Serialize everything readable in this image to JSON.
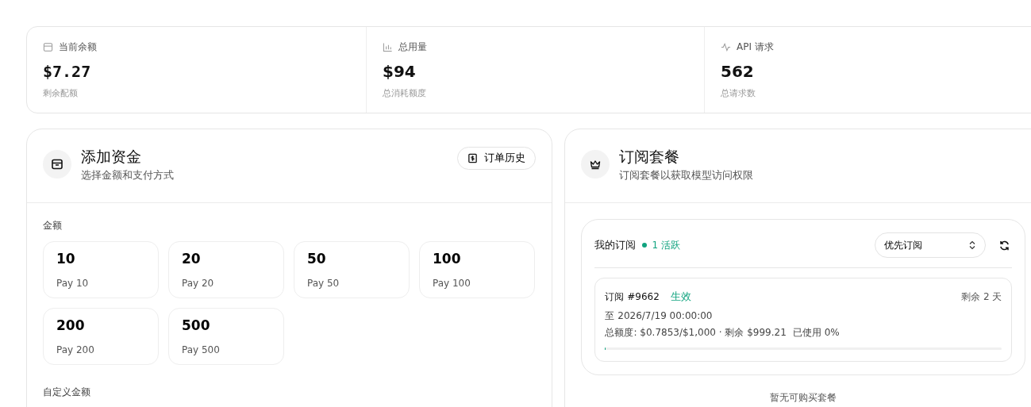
{
  "stats": [
    {
      "label": "当前余额",
      "value": "$7.27",
      "caption": "剩余配额"
    },
    {
      "label": "总用量",
      "value": "$94",
      "caption": "总消耗额度"
    },
    {
      "label": "API 请求",
      "value": "562",
      "caption": "总请求数"
    }
  ],
  "add_funds": {
    "title": "添加资金",
    "subtitle": "选择金额和支付方式",
    "history_button": "订单历史",
    "amount_label": "金额",
    "amounts": [
      {
        "value": "10",
        "pay": "Pay 10",
        "selected": false
      },
      {
        "value": "20",
        "pay": "Pay 20",
        "selected": false
      },
      {
        "value": "50",
        "pay": "Pay 50",
        "selected": false
      },
      {
        "value": "100",
        "pay": "Pay 100",
        "selected": false
      },
      {
        "value": "200",
        "pay": "Pay 200",
        "selected": false
      },
      {
        "value": "500",
        "pay": "Pay 500",
        "selected": false
      }
    ],
    "custom_label": "自定义金额"
  },
  "subscriptions": {
    "title": "订阅套餐",
    "subtitle": "订阅套餐以获取模型访问权限",
    "my_label": "我的订阅",
    "active_count": "1 活跃",
    "sort_select": "优先订阅",
    "items": [
      {
        "name": "订阅 #9662",
        "status": "生效",
        "active": true,
        "remaining": "剩余 2 天",
        "until": "至 2026/7/19 00:00:00",
        "quota": "总额度: $0.7853/$1,000 · 剩余 $999.21",
        "used": "已使用 0%",
        "level": 0.0008
      }
    ],
    "empty_text": "暂无可购买套餐"
  }
}
